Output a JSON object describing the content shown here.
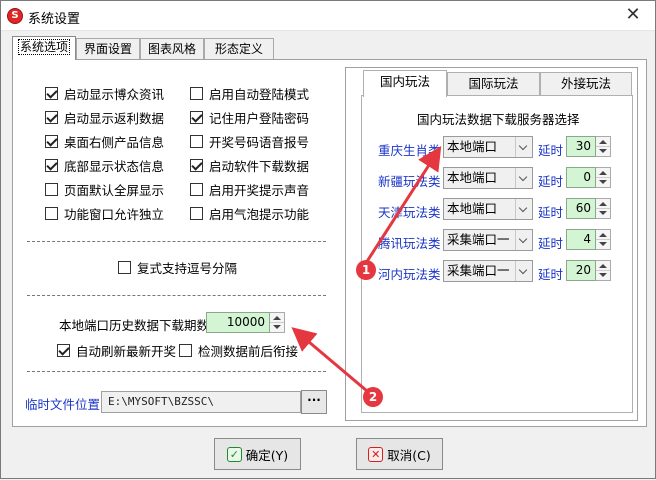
{
  "window": {
    "title": "系统设置",
    "app_icon": "lottery-app-icon",
    "close_glyph": "✕"
  },
  "tabs": [
    "系统选项",
    "界面设置",
    "图表风格",
    "形态定义"
  ],
  "left_checks": [
    {
      "label": "启动显示博众资讯",
      "checked": true
    },
    {
      "label": "启动显示返利数据",
      "checked": true
    },
    {
      "label": "桌面右侧产品信息",
      "checked": true
    },
    {
      "label": "底部显示状态信息",
      "checked": true
    },
    {
      "label": "页面默认全屏显示",
      "checked": false
    },
    {
      "label": "功能窗口允许独立",
      "checked": false
    }
  ],
  "right_checks": [
    {
      "label": "启用自动登陆模式",
      "checked": false
    },
    {
      "label": "记住用户登陆密码",
      "checked": true
    },
    {
      "label": "开奖号码语音报号",
      "checked": false
    },
    {
      "label": "启动软件下载数据",
      "checked": true
    },
    {
      "label": "启用开奖提示声音",
      "checked": false
    },
    {
      "label": "启用气泡提示功能",
      "checked": false
    }
  ],
  "compound": {
    "label": "复式支持逗号分隔",
    "checked": false
  },
  "history": {
    "label": "本地端口历史数据下载期数",
    "value": "10000"
  },
  "auto_refresh": {
    "label": "自动刷新最新开奖",
    "checked": true
  },
  "check_before": {
    "label": "检测数据前后衔接",
    "checked": false
  },
  "temp_file": {
    "label": "临时文件位置",
    "path": "E:\\MYSOFT\\BZSSC\\",
    "browse": "···"
  },
  "server": {
    "tabs": [
      "国内玩法",
      "国际玩法",
      "外接玩法"
    ],
    "heading": "国内玩法数据下载服务器选择",
    "delay_label": "延时",
    "rows": [
      {
        "name": "重庆生肖类",
        "port": "本地端口",
        "delay": "30"
      },
      {
        "name": "新疆玩法类",
        "port": "本地端口",
        "delay": "0"
      },
      {
        "name": "天津玩法类",
        "port": "本地端口",
        "delay": "60"
      },
      {
        "name": "腾讯玩法类",
        "port": "采集端口一",
        "delay": "4"
      },
      {
        "name": "河内玩法类",
        "port": "采集端口一",
        "delay": "20"
      }
    ]
  },
  "buttons": {
    "ok": "确定(Y)",
    "cancel": "取消(C)",
    "ok_icon": "✓",
    "cancel_icon": "✕"
  },
  "callouts": [
    "1",
    "2"
  ],
  "colors": {
    "accent_blue": "#1a35c8",
    "spin_bg": "#d4f5d4",
    "callout_red": "#e5373f"
  }
}
